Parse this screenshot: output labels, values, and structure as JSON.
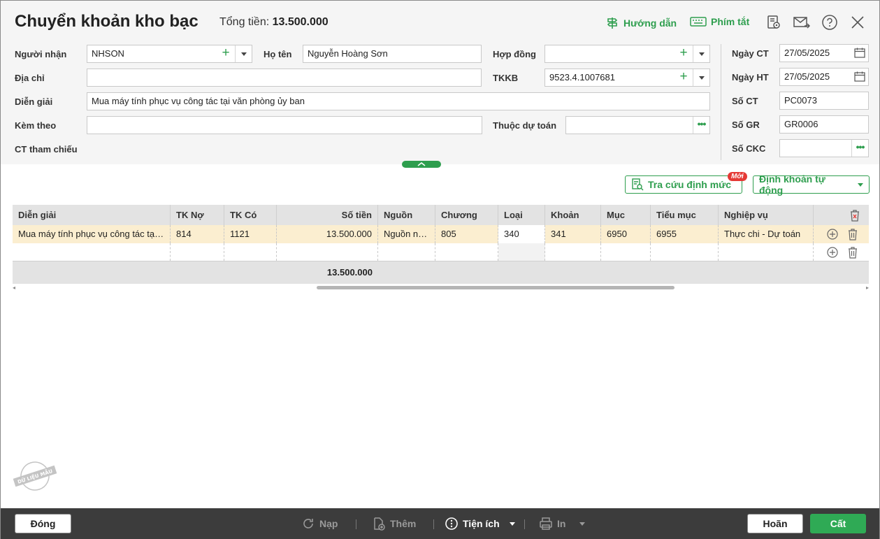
{
  "header": {
    "title": "Chuyển khoản kho bạc",
    "total_label": "Tổng tiền: ",
    "total_value": "13.500.000",
    "guide_label": "Hướng dẫn",
    "shortcut_label": "Phím tắt"
  },
  "form": {
    "nguoi_nhan_label": "Người nhận",
    "nguoi_nhan_value": "NHSON",
    "ho_ten_label": "Họ tên",
    "ho_ten_value": "Nguyễn Hoàng Sơn",
    "hop_dong_label": "Hợp đồng",
    "hop_dong_value": "",
    "dia_chi_label": "Địa chỉ",
    "dia_chi_value": "",
    "tkkb_label": "TKKB",
    "tkkb_value": "9523.4.1007681",
    "dien_giai_label": "Diễn giải",
    "dien_giai_value": "Mua máy tính phục vụ công tác tại văn phòng ủy ban",
    "kem_theo_label": "Kèm theo",
    "kem_theo_value": "",
    "thuoc_du_toan_label": "Thuộc dự toán",
    "thuoc_du_toan_value": "",
    "ct_tham_chieu_label": "CT tham chiếu"
  },
  "right_panel": {
    "ngay_ct_label": "Ngày CT",
    "ngay_ct_value": "27/05/2025",
    "ngay_ht_label": "Ngày HT",
    "ngay_ht_value": "27/05/2025",
    "so_ct_label": "Số CT",
    "so_ct_value": "PC0073",
    "so_gr_label": "Số GR",
    "so_gr_value": "GR0006",
    "so_ckc_label": "Số CKC",
    "so_ckc_value": ""
  },
  "actions": {
    "lookup_label": "Tra cứu định mức",
    "new_badge": "Mới",
    "auto_label": "Định khoản tự động"
  },
  "table": {
    "columns": [
      "Diễn giải",
      "TK Nợ",
      "TK Có",
      "Số tiền",
      "Nguồn",
      "Chương",
      "Loại",
      "Khoản",
      "Mục",
      "Tiểu mục",
      "Nghiệp vụ"
    ],
    "rows": [
      [
        "Mua máy tính phục vụ công tác tại văn phòng ủy ban",
        "814",
        "1121",
        "13.500.000",
        "Nguồn ngân sách",
        "805",
        "340",
        "341",
        "6950",
        "6955",
        "Thực chi - Dự toán"
      ]
    ],
    "total": "13.500.000"
  },
  "stamp_text": "DỮ LIỆU MẪU",
  "footer": {
    "close_label": "Đóng",
    "reload_label": "Nạp",
    "add_label": "Thêm",
    "utility_label": "Tiện ích",
    "print_label": "In",
    "cancel_label": "Hoãn",
    "save_label": "Cất"
  },
  "colors": {
    "accent": "#2e9e4e",
    "row_highlight": "#fbeed0",
    "footer_bg": "#3c3c3c"
  }
}
